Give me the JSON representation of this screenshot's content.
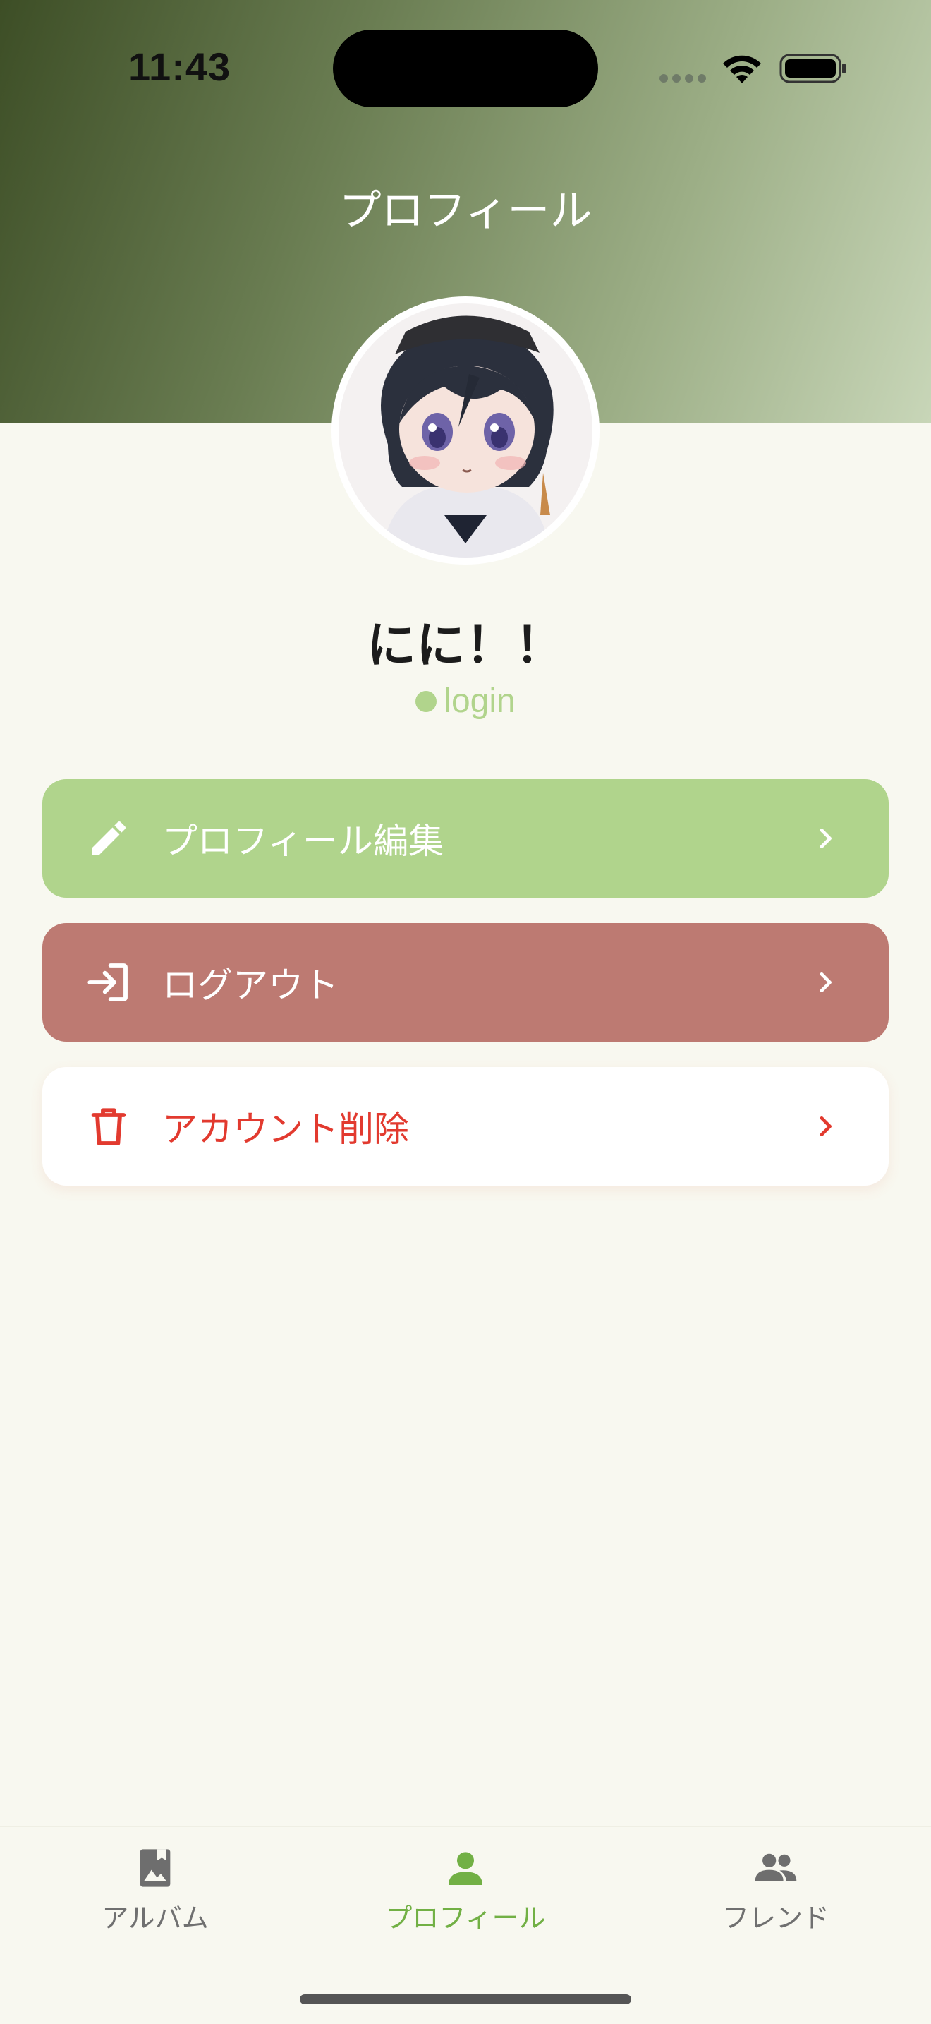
{
  "status_bar": {
    "time": "11:43"
  },
  "header": {
    "title": "プロフィール"
  },
  "profile": {
    "name": "にに！！",
    "status": "login",
    "status_color": "#b1d48c"
  },
  "menu": {
    "edit_label": "プロフィール編集",
    "logout_label": "ログアウト",
    "delete_label": "アカウント削除"
  },
  "tabs": [
    {
      "label": "アルバム",
      "icon": "album-icon",
      "active": false
    },
    {
      "label": "プロフィール",
      "icon": "person-icon",
      "active": true
    },
    {
      "label": "フレンド",
      "icon": "people-icon",
      "active": false
    }
  ],
  "colors": {
    "accent_green": "#b0d48c",
    "active_tab": "#72b045",
    "logout_red": "#bd7a72",
    "delete_red": "#e23a2f",
    "background": "#f8f8f0"
  }
}
